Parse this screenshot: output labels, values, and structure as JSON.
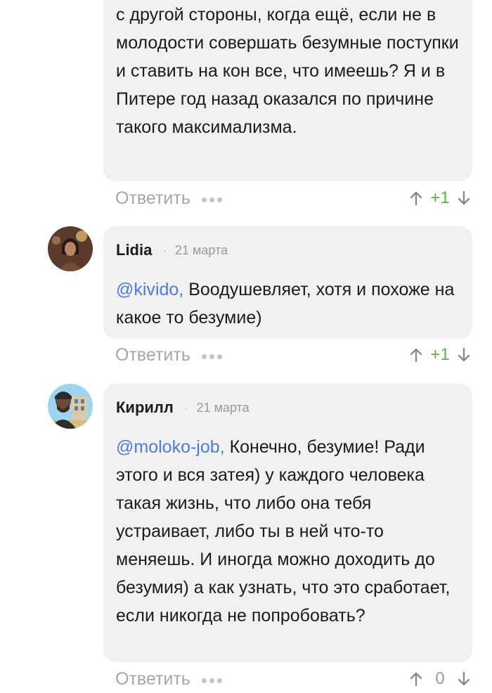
{
  "comments": [
    {
      "text": "с другой стороны, когда ещё, если не в молодости совершать безумные поступки и ставить на кон все, что имеешь? Я и в Питере год назад оказался по причине такого максимализма.",
      "reply_label": "Ответить",
      "score": "+1"
    },
    {
      "author": "Lidia",
      "dot": "·",
      "date": "21 марта",
      "mention": "@kivido,",
      "text": "Воодушевляет, хотя и похоже на какое то безумие)",
      "reply_label": "Ответить",
      "score": "+1"
    },
    {
      "author": "Кирилл",
      "dot": "·",
      "date": "21 марта",
      "mention": "@moloko-job,",
      "text": "Конечно, безумие! Ради этого и вся затея) у каждого человека такая жизнь, что либо она тебя устраивает, либо ты в ней что-то меняешь. И иногда можно доходить до безумия) а как узнать, что это сработает, если никогда не попробовать?",
      "reply_label": "Ответить",
      "score": "0"
    }
  ],
  "colors": {
    "bubble": "#f1f1f1",
    "mention": "#4f7ad6",
    "positive_score": "#5fb04a",
    "muted": "#a6a6a6"
  },
  "icons": [
    "more-dots-icon",
    "upvote-arrow-icon",
    "downvote-arrow-icon"
  ]
}
